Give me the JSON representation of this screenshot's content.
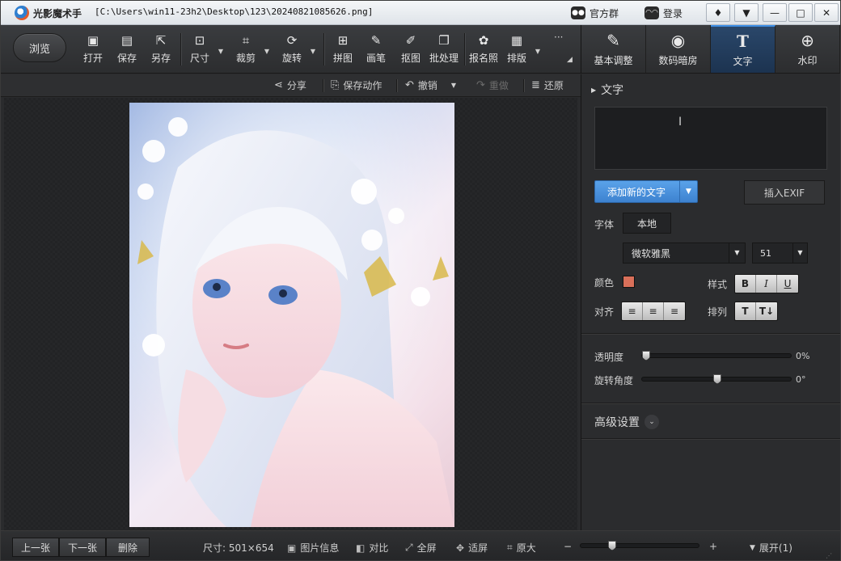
{
  "window": {
    "app_name": "光影魔术手",
    "file_path": "[C:\\Users\\win11-23h2\\Desktop\\123\\20240821085626.png]",
    "official_group": "官方群",
    "login": "登录"
  },
  "toolbar": {
    "browse": "浏览",
    "tools": [
      {
        "label": "打开",
        "icon": "open-image-icon"
      },
      {
        "label": "保存",
        "icon": "save-icon"
      },
      {
        "label": "另存",
        "icon": "save-as-icon"
      },
      {
        "label": "尺寸",
        "icon": "resize-icon"
      },
      {
        "label": "裁剪",
        "icon": "crop-icon"
      },
      {
        "label": "旋转",
        "icon": "rotate-icon"
      },
      {
        "label": "拼图",
        "icon": "collage-icon"
      },
      {
        "label": "画笔",
        "icon": "brush-icon"
      },
      {
        "label": "抠图",
        "icon": "cutout-icon"
      },
      {
        "label": "批处理",
        "icon": "batch-icon"
      },
      {
        "label": "报名照",
        "icon": "id-photo-icon"
      },
      {
        "label": "排版",
        "icon": "layout-icon"
      }
    ],
    "more": "···"
  },
  "right_tabs": [
    {
      "label": "基本调整",
      "icon": "edit-icon"
    },
    {
      "label": "数码暗房",
      "icon": "camera-icon"
    },
    {
      "label": "文字",
      "icon": "text-icon",
      "active": true
    },
    {
      "label": "水印",
      "icon": "watermark-icon"
    }
  ],
  "actionbar": {
    "share": "分享",
    "save_action": "保存动作",
    "undo": "撤销",
    "redo": "重做",
    "restore": "还原"
  },
  "text_panel": {
    "section_title": "文字",
    "text_cursor": "I",
    "add_text": "添加新的文字",
    "insert_exif": "插入EXIF",
    "font_label": "字体",
    "font_source": "本地",
    "font_name": "微软雅黑",
    "font_size": "51",
    "color_label": "颜色",
    "color_value": "#d9705a",
    "style_label": "样式",
    "style_buttons": [
      "B",
      "I",
      "U"
    ],
    "align_label": "对齐",
    "arrange_label": "排列",
    "opacity_label": "透明度",
    "opacity_value": "0%",
    "opacity": 0,
    "rotation_label": "旋转角度",
    "rotation_value": "0°",
    "rotation_fraction": 0.5,
    "advanced": "高级设置"
  },
  "statusbar": {
    "prev": "上一张",
    "next": "下一张",
    "delete": "删除",
    "size": "尺寸: 501×654",
    "image_info": "图片信息",
    "compare": "对比",
    "fullscreen": "全屏",
    "fit": "适屏",
    "original": "原大",
    "zoom_minus": "−",
    "zoom_plus": "+",
    "expand": "展开(1)"
  }
}
